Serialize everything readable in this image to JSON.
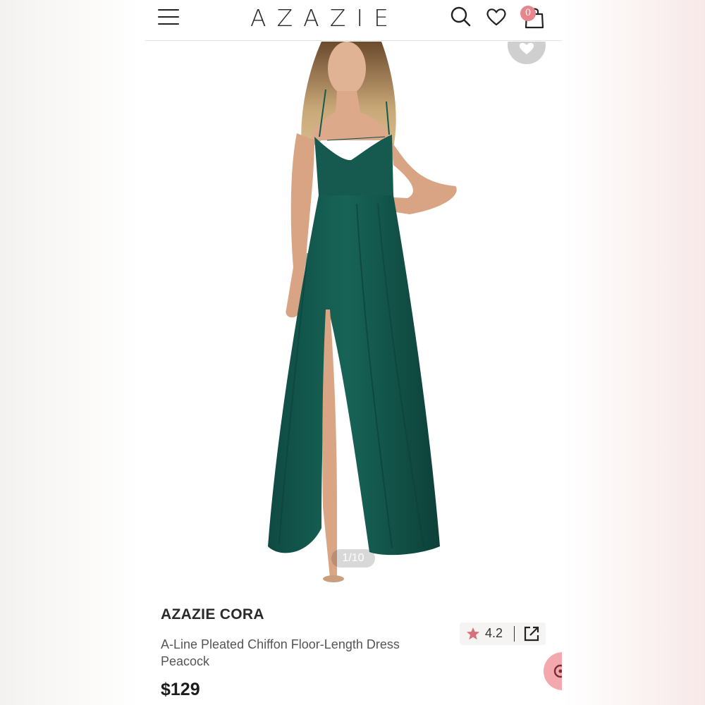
{
  "header": {
    "brand": "AZAZIE",
    "cart_count": "0",
    "icons": [
      "hamburger-menu-icon",
      "search-icon",
      "heart-icon",
      "shopping-bag-icon"
    ]
  },
  "gallery": {
    "pager": "1/10",
    "image_subject": "model wearing a peacock green chiffon dress",
    "dress_color": "#13564d"
  },
  "product": {
    "name": "AZAZIE CORA",
    "description": "A-Line Pleated Chiffon Floor-Length Dress Peacock",
    "price": "$129",
    "rating": "4.2"
  },
  "colors": {
    "accent_pink": "#e7868e",
    "star": "#d6707b",
    "text": "#2a2a2a"
  }
}
